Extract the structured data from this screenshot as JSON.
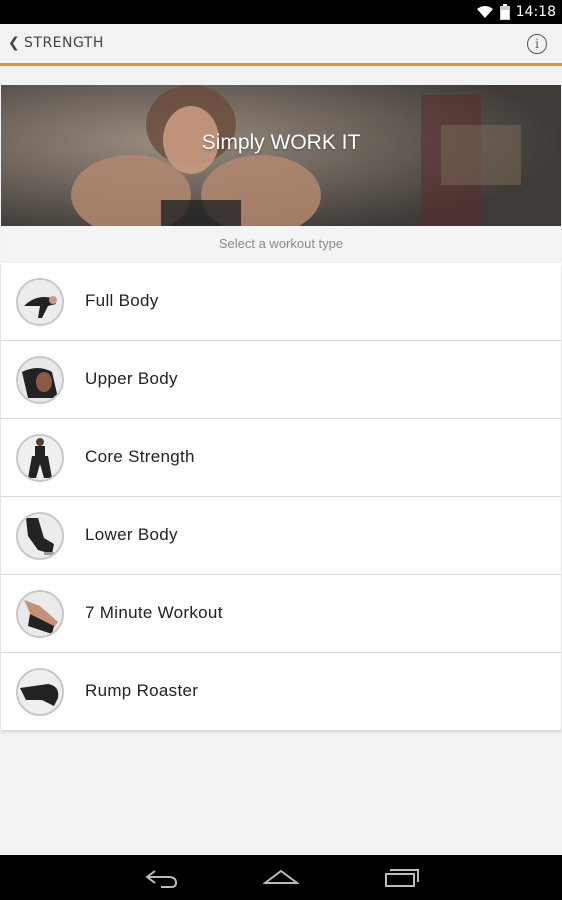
{
  "status_bar": {
    "time": "14:18"
  },
  "action_bar": {
    "back_icon": "chevron-left-icon",
    "title": "STRENGTH",
    "info_label": "i"
  },
  "hero": {
    "text": "Simply WORK IT"
  },
  "subheader": {
    "text": "Select a workout type"
  },
  "workouts": [
    {
      "label": "Full Body"
    },
    {
      "label": "Upper Body"
    },
    {
      "label": "Core Strength"
    },
    {
      "label": "Lower Body"
    },
    {
      "label": "7 Minute Workout"
    },
    {
      "label": "Rump Roaster"
    }
  ],
  "colors": {
    "accent": "#f08a32",
    "background": "#f2f2f2",
    "navbar": "#000000"
  }
}
